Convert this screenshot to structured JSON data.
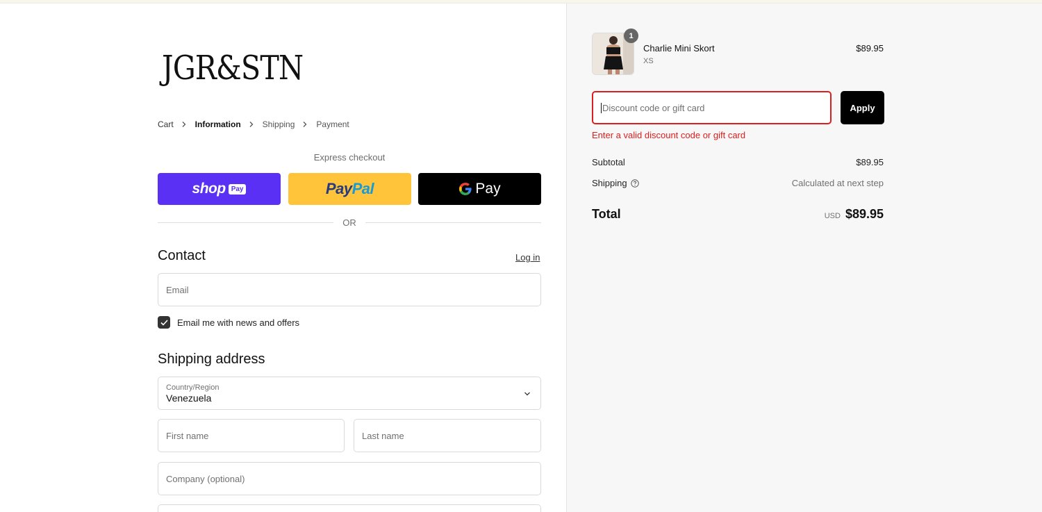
{
  "brand": {
    "logo_text": "JGR&STN"
  },
  "breadcrumb": {
    "items": [
      "Cart",
      "Information",
      "Shipping",
      "Payment"
    ]
  },
  "express": {
    "label": "Express checkout",
    "shop_pay": {
      "word": "shop",
      "tag": "Pay"
    },
    "paypal": {
      "part1": "Pay",
      "part2": "Pal"
    },
    "gpay": {
      "text": "Pay"
    },
    "or_text": "OR"
  },
  "contact": {
    "title": "Contact",
    "login_label": "Log in",
    "email_placeholder": "Email",
    "newsletter_label": "Email me with news and offers",
    "newsletter_checked": true
  },
  "shipping_address": {
    "title": "Shipping address",
    "country_label": "Country/Region",
    "country_value": "Venezuela",
    "first_name_placeholder": "First name",
    "last_name_placeholder": "Last name",
    "company_placeholder": "Company (optional)"
  },
  "order": {
    "item": {
      "name": "Charlie Mini Skort",
      "variant": "XS",
      "price": "$89.95",
      "quantity": "1"
    },
    "discount_placeholder": "Discount code or gift card",
    "apply_label": "Apply",
    "discount_error": "Enter a valid discount code or gift card",
    "subtotal_label": "Subtotal",
    "subtotal_value": "$89.95",
    "shipping_label": "Shipping",
    "shipping_value": "Calculated at next step",
    "total_label": "Total",
    "currency": "USD",
    "total_value": "$89.95"
  },
  "colors": {
    "shop_pay": "#5a31f4",
    "paypal": "#ffc439",
    "error": "#dd1d1d"
  }
}
